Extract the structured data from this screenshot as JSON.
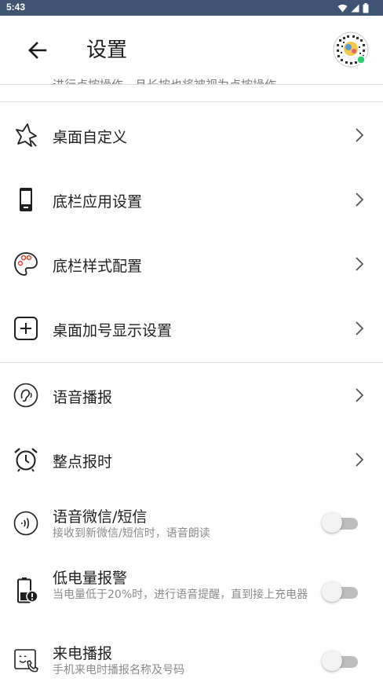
{
  "status_bar": {
    "time": "5:43",
    "icons": [
      "wifi-icon",
      "signal-icon",
      "battery-icon"
    ],
    "background": "#3d5572"
  },
  "header": {
    "title": "设置",
    "back_icon": "arrow-left-icon",
    "avatar_icon": "qr-code-avatar"
  },
  "partial_text": "进行点按操作，且长按也将被视为点按操作",
  "settings": [
    {
      "label": "桌面自定义",
      "icon": "star-outline-icon",
      "control": "chevron"
    },
    {
      "label": "底栏应用设置",
      "icon": "phone-device-icon",
      "control": "chevron"
    },
    {
      "label": "底栏样式配置",
      "icon": "palette-icon",
      "control": "chevron"
    },
    {
      "label": "桌面加号显示设置",
      "icon": "plus-square-icon",
      "control": "chevron"
    },
    {
      "label": "语音播报",
      "icon": "ear-sound-icon",
      "control": "chevron"
    },
    {
      "label": "整点报时",
      "icon": "alarm-clock-icon",
      "control": "chevron"
    },
    {
      "label": "语音微信/短信",
      "subtitle": "接收到新微信/短信时，语音朗读",
      "icon": "speaker-waves-icon",
      "control": "toggle",
      "enabled": false
    },
    {
      "label": "低电量报警",
      "subtitle": "当电量低于20%时，进行语音提醒，直到接上充电器",
      "icon": "battery-alert-icon",
      "control": "toggle",
      "enabled": false
    },
    {
      "label": "来电播报",
      "subtitle": "手机来电时播报名称及号码",
      "icon": "incoming-call-icon",
      "control": "toggle",
      "enabled": false
    }
  ]
}
